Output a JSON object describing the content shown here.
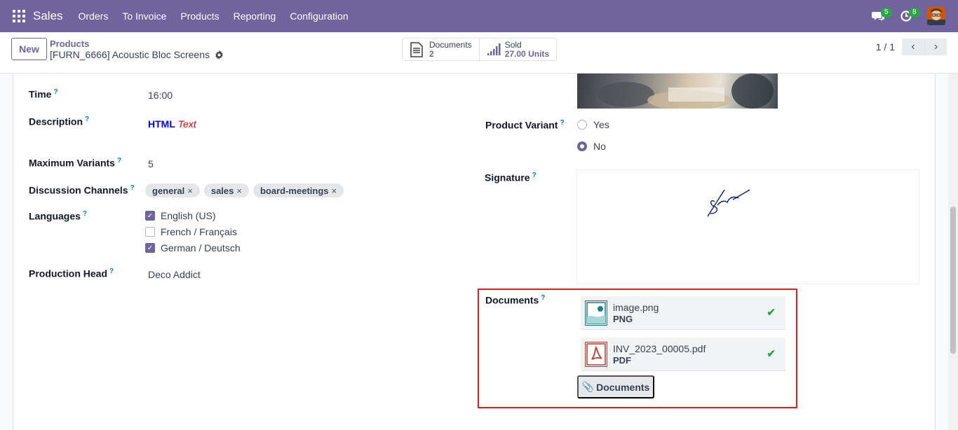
{
  "navbar": {
    "app_name": "Sales",
    "menu": [
      "Orders",
      "To Invoice",
      "Products",
      "Reporting",
      "Configuration"
    ],
    "messages_count": "5",
    "activities_count": "8"
  },
  "control": {
    "new_label": "New",
    "breadcrumb_parent": "Products",
    "breadcrumb_current": "[FURN_6666] Acoustic Bloc Screens",
    "smart_documents_label": "Documents",
    "smart_documents_value": "2",
    "smart_sold_label": "Sold",
    "smart_sold_value": "27.00 Units",
    "pager": "1 / 1"
  },
  "form": {
    "time_label": "Time",
    "time_value": "16:00",
    "description_label": "Description",
    "description_html": "HTML",
    "description_text": "Text",
    "max_variants_label": "Maximum Variants",
    "max_variants_value": "5",
    "channels_label": "Discussion Channels",
    "channels": [
      "general",
      "sales",
      "board-meetings"
    ],
    "languages_label": "Languages",
    "languages": [
      {
        "label": "English (US)",
        "checked": true
      },
      {
        "label": "French / Français",
        "checked": false
      },
      {
        "label": "German / Deutsch",
        "checked": true
      }
    ],
    "production_head_label": "Production Head",
    "production_head_value": "Deco Addict",
    "product_variant_label": "Product Variant",
    "variant_options": [
      {
        "label": "Yes",
        "selected": false
      },
      {
        "label": "No",
        "selected": true
      }
    ],
    "signature_label": "Signature",
    "documents_label": "Documents",
    "documents": [
      {
        "name": "image.png",
        "type": "PNG",
        "icon": "image-file-icon"
      },
      {
        "name": "INV_2023_00005.pdf",
        "type": "PDF",
        "icon": "pdf-file-icon"
      }
    ],
    "documents_button": "Documents"
  },
  "colors": {
    "brand": "#71639e",
    "highlight": "#e02020",
    "success": "#28a745"
  }
}
